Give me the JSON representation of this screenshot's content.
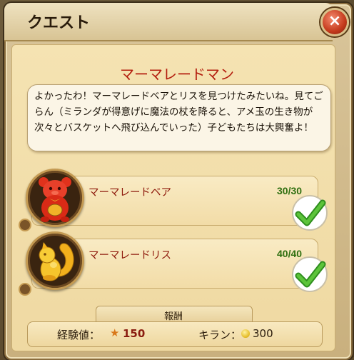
{
  "window": {
    "title": "クエスト",
    "close_icon": "×"
  },
  "quest": {
    "name": "マーマレードマン",
    "dialogue": "よかったわ！マーマレードベアとリスを見つけたみたいね。見てごらん（ミランダが得意げに魔法の杖を降ると、アメ玉の生き物が次々とバスケットへ飛び込んでいった）子どもたちは大興奮よ！"
  },
  "objectives": [
    {
      "label": "マーマレードベア",
      "progress": "30/30",
      "current": 30,
      "total": 30,
      "completed": true,
      "icon": "gummy-bear-icon"
    },
    {
      "label": "マーマレードリス",
      "progress": "40/40",
      "current": 40,
      "total": 40,
      "completed": true,
      "icon": "candy-squirrel-icon"
    }
  ],
  "reward": {
    "title": "報酬",
    "exp_label": "経験値：",
    "exp_value": "150",
    "kiran_label": "キラン：",
    "kiran_value": "300"
  },
  "colors": {
    "quest_name": "#b41f0f",
    "objective_label": "#8e1a0c",
    "progress": "#2f6f10",
    "check": "#3aa52a"
  }
}
